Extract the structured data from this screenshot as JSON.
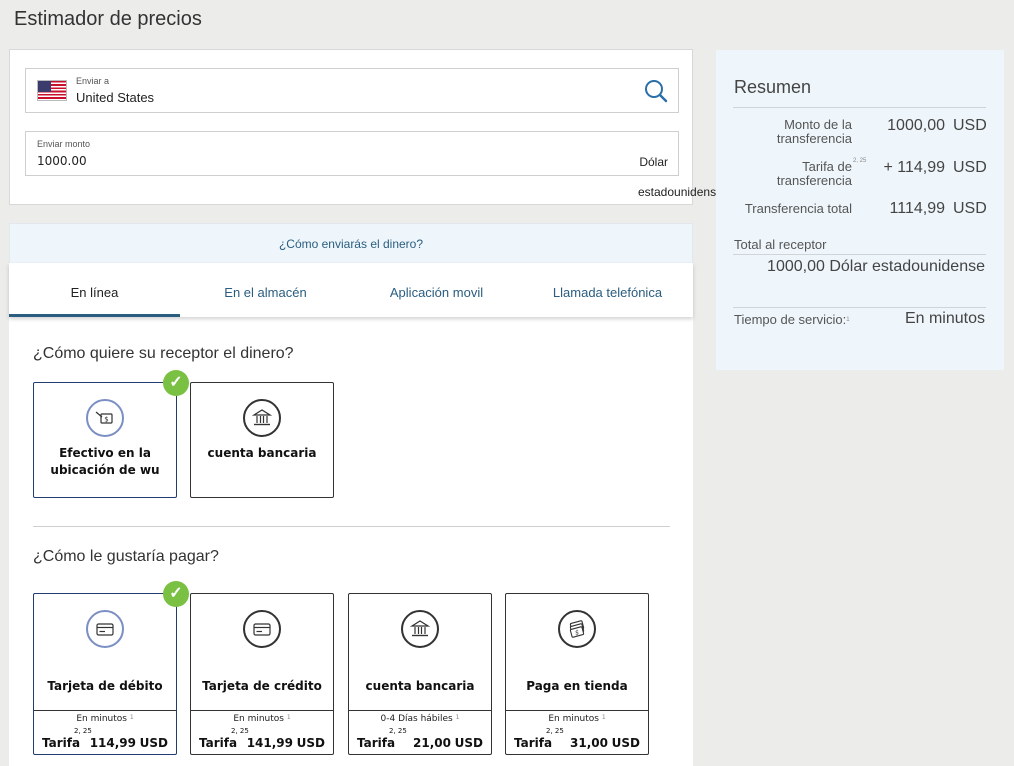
{
  "page": {
    "title": "Estimador de precios"
  },
  "send": {
    "dest_label": "Enviar a",
    "dest_value": "United States",
    "amount_label": "Enviar monto",
    "amount_value": "1000.00",
    "currency_line1": "Dólar",
    "currency_line2": "estadounidense"
  },
  "summary": {
    "title": "Resumen",
    "transfer_amount_label": "Monto de la transferencia",
    "transfer_amount_value": "1000,00",
    "transfer_amount_currency": "USD",
    "fee_label": "Tarifa de transferencia",
    "fee_sup": "2, 25",
    "fee_value": "+ 114,99",
    "fee_currency": "USD",
    "total_label": "Transferencia total",
    "total_value": "1114,99",
    "total_currency": "USD",
    "receiver_label": "Total al receptor",
    "receiver_value": "1000,00 Dólar estadounidense",
    "service_time_label": "Tiempo de servicio:",
    "service_time_sup": "1",
    "service_time_value": "En minutos"
  },
  "how_send": "¿Cómo enviarás el dinero?",
  "tabs": [
    {
      "label": "En línea",
      "active": true
    },
    {
      "label": "En el almacén",
      "active": false
    },
    {
      "label": "Aplicación movil",
      "active": false
    },
    {
      "label": "Llamada telefónica",
      "active": false
    }
  ],
  "receive": {
    "question": "¿Cómo quiere su receptor el dinero?",
    "options": [
      {
        "label": "Efectivo en la ubicación de wu",
        "icon": "cash-hand-icon",
        "selected": true
      },
      {
        "label": "cuenta bancaria",
        "icon": "bank-icon",
        "selected": false
      }
    ]
  },
  "pay": {
    "question": "¿Cómo le gustaría pagar?",
    "options": [
      {
        "label": "Tarjeta de débito",
        "icon": "debit-card-icon",
        "selected": true,
        "time": "En minutos",
        "time_sup": "1",
        "fee_label": "Tarifa",
        "fee_sup": "2, 25",
        "fee_amount": "114,99",
        "fee_currency": "USD"
      },
      {
        "label": "Tarjeta de crédito",
        "icon": "credit-card-icon",
        "selected": false,
        "time": "En minutos",
        "time_sup": "1",
        "fee_label": "Tarifa",
        "fee_sup": "2, 25",
        "fee_amount": "141,99",
        "fee_currency": "USD"
      },
      {
        "label": "cuenta bancaria",
        "icon": "bank-icon",
        "selected": false,
        "time": "0-4  Días hábiles",
        "time_sup": "1",
        "fee_label": "Tarifa",
        "fee_sup": "2, 25",
        "fee_amount": "21,00",
        "fee_currency": "USD"
      },
      {
        "label": "Paga en tienda",
        "icon": "cash-stack-icon",
        "selected": false,
        "time": "En minutos",
        "time_sup": "1",
        "fee_label": "Tarifa",
        "fee_sup": "2, 25",
        "fee_amount": "31,00",
        "fee_currency": "USD"
      }
    ]
  },
  "colors": {
    "accent": "#2a5d80",
    "check": "#7ac143",
    "selected_border": "#243b72",
    "summary_bg": "#eef6fb"
  }
}
